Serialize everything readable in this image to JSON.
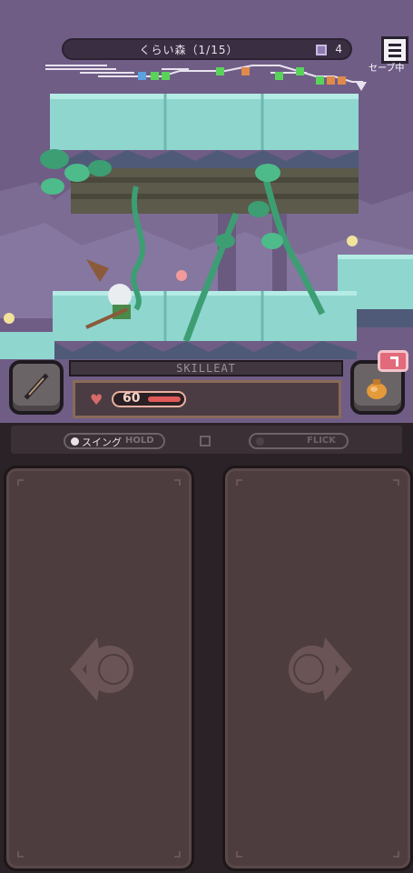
{
  "header": {
    "stage_title": "くらい森（1/15）",
    "cube_count": "4",
    "menu_label": "セーブ中"
  },
  "hud": {
    "skill_label": "SKILLEAT",
    "hp_value": "60",
    "hp_fraction": 0.6
  },
  "controls": {
    "swing_label": "スイング",
    "hold_label": "HOLD",
    "flick_label": "FLICK"
  },
  "icons": {
    "weapon": "sword-icon",
    "item": "pouch-icon",
    "badge": "corner-arrow-icon",
    "left_pad": "left-arrow-icon",
    "right_pad": "right-arrow-icon"
  },
  "colors": {
    "scene_bg": "#6f5d86",
    "platform_top": "#8fd6cf",
    "vine": "#3d9e74",
    "hp_bar": "#e05a5a",
    "pad_bg": "#4d3d3f",
    "badge": "#e26a7a"
  }
}
